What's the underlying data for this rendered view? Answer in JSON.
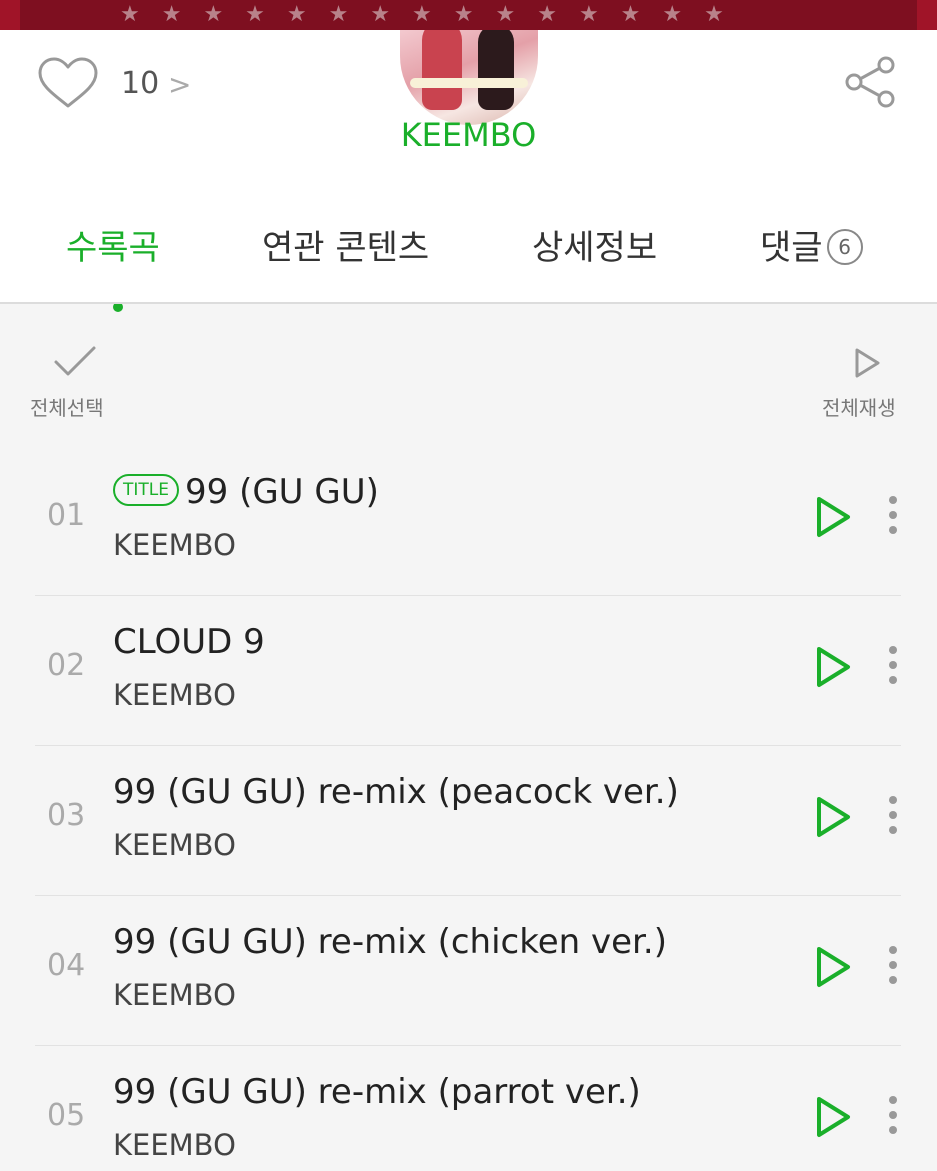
{
  "header": {
    "like_count": "10",
    "like_chevron": ">",
    "artist_name": "KEEMBO"
  },
  "tabs": [
    {
      "label": "수록곡",
      "active": true
    },
    {
      "label": "연관 콘텐츠",
      "active": false
    },
    {
      "label": "상세정보",
      "active": false
    },
    {
      "label": "댓글",
      "active": false,
      "count": "6"
    }
  ],
  "toolbar": {
    "select_all_label": "전체선택",
    "play_all_label": "전체재생"
  },
  "tracks": [
    {
      "number": "01",
      "badge": "TITLE",
      "title": "99 (GU GU)",
      "artist": "KEEMBO"
    },
    {
      "number": "02",
      "badge": "",
      "title": "CLOUD 9",
      "artist": "KEEMBO"
    },
    {
      "number": "03",
      "badge": "",
      "title": "99 (GU GU) re-mix (peacock ver.)",
      "artist": "KEEMBO"
    },
    {
      "number": "04",
      "badge": "",
      "title": "99 (GU GU) re-mix (chicken ver.)",
      "artist": "KEEMBO"
    },
    {
      "number": "05",
      "badge": "",
      "title": "99 (GU GU) re-mix (parrot ver.)",
      "artist": "KEEMBO"
    }
  ],
  "colors": {
    "accent": "#1aaf2a",
    "banner": "#a01428"
  },
  "icons": {
    "like": "heart-icon",
    "share": "share-icon",
    "select_all": "checkmark-icon",
    "play": "play-icon",
    "more": "more-vertical-icon"
  }
}
